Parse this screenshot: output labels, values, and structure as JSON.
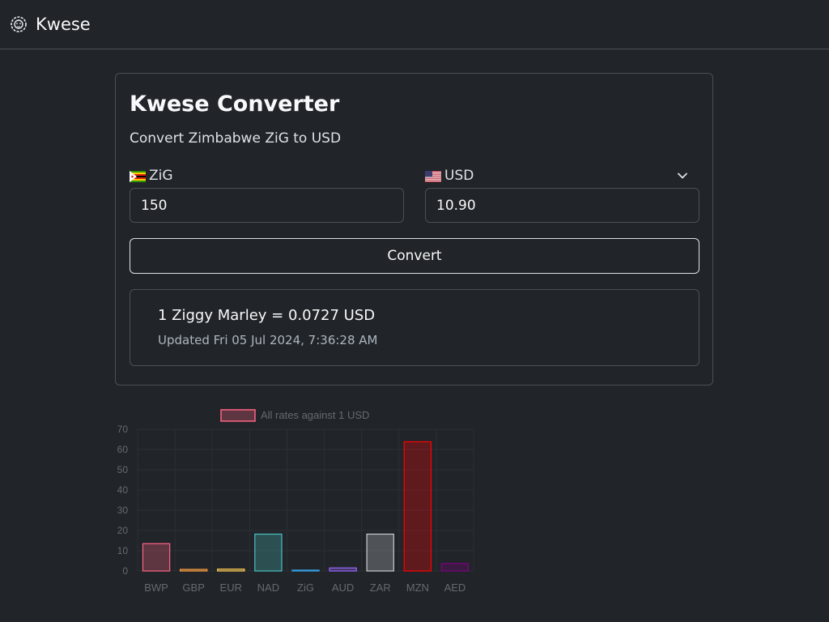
{
  "navbar": {
    "brand": "Kwese",
    "logo_icon": "lion-icon"
  },
  "converter": {
    "title": "Kwese Converter",
    "subtitle": "Convert Zimbabwe ZiG to USD",
    "from": {
      "label": "ZiG",
      "flag": "zimbabwe-flag-icon",
      "value": "150"
    },
    "to": {
      "label": "USD",
      "flag": "us-flag-icon",
      "value": "10.90"
    },
    "convert_label": "Convert",
    "result": {
      "rate": "1 Ziggy Marley = 0.0727 USD",
      "updated": "Updated Fri 05 Jul 2024, 7:36:28 AM"
    }
  },
  "chart_data": {
    "type": "bar",
    "legend": "All rates against 1 USD",
    "categories": [
      "BWP",
      "GBP",
      "EUR",
      "NAD",
      "ZiG",
      "AUD",
      "ZAR",
      "MZN",
      "AED"
    ],
    "values": [
      13.5,
      0.78,
      0.92,
      18.2,
      0.07,
      1.49,
      18.2,
      63.8,
      3.67
    ],
    "colors": [
      "#ff6384",
      "#ff9f40",
      "#ffcd56",
      "#4bc0c0",
      "#36a2eb",
      "#9966ff",
      "#c9cbcf",
      "#ff0000",
      "#800080"
    ],
    "ylim": [
      0,
      70
    ],
    "yticks": [
      0,
      10,
      20,
      30,
      40,
      50,
      60,
      70
    ],
    "grid": true,
    "legend_position": "top"
  }
}
